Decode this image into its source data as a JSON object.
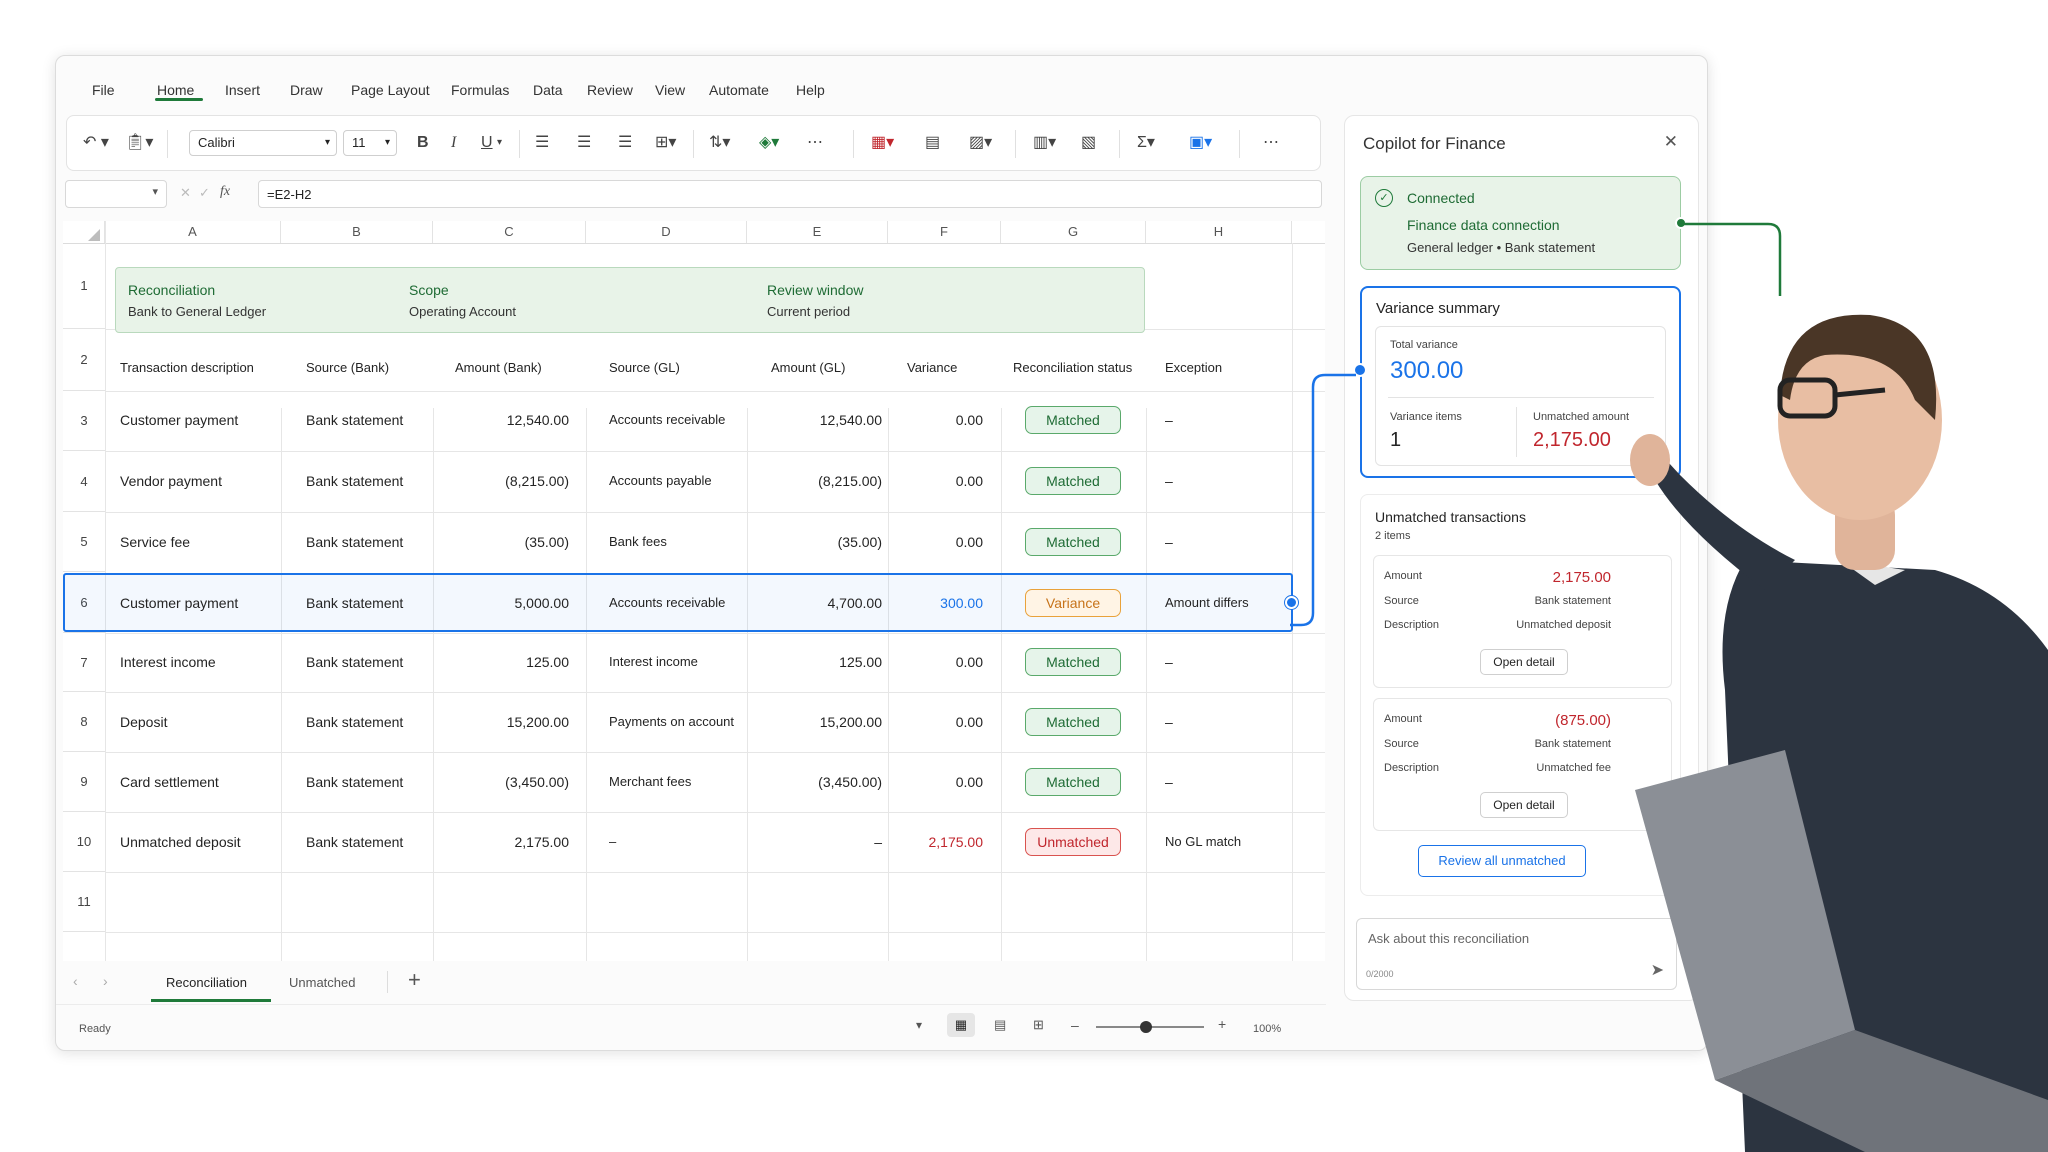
{
  "menu": [
    "File",
    "Home",
    "Insert",
    "Draw",
    "Page Layout",
    "Formulas",
    "Data",
    "Review",
    "View",
    "Automate",
    "Help"
  ],
  "ribbon": {
    "font": "Calibri",
    "size": "11",
    "bold": "B",
    "italic": "I",
    "underline": "U"
  },
  "formula_bar": {
    "fx": "fx",
    "formula": "=E2-H2"
  },
  "columns": [
    "A",
    "B",
    "C",
    "D",
    "E",
    "F",
    "G",
    "H"
  ],
  "banner": {
    "reconciliation_label": "Reconciliation",
    "reconciliation_value": "Bank to General Ledger",
    "scope_label": "Scope",
    "scope_value": "Operating Account",
    "window_label": "Review window",
    "window_value": "Current period"
  },
  "headers": [
    "Transaction description",
    "Source (Bank)",
    "Amount (Bank)",
    "Source (GL)",
    "Amount (GL)",
    "Variance",
    "Reconciliation status",
    "Exception"
  ],
  "row_numbers": [
    "1",
    "2",
    "3",
    "4",
    "5",
    "6",
    "7",
    "8",
    "9",
    "10",
    "11"
  ],
  "rows": [
    {
      "desc": "Customer payment",
      "src_bank": "Bank statement",
      "amt_bank": "12,540.00",
      "src_gl": "Accounts receivable",
      "amt_gl": "12,540.00",
      "variance": "0.00",
      "status": "Matched",
      "exception": "–"
    },
    {
      "desc": "Vendor payment",
      "src_bank": "Bank statement",
      "amt_bank": "(8,215.00)",
      "src_gl": "Accounts payable",
      "amt_gl": "(8,215.00)",
      "variance": "0.00",
      "status": "Matched",
      "exception": "–"
    },
    {
      "desc": "Service fee",
      "src_bank": "Bank statement",
      "amt_bank": "(35.00)",
      "src_gl": "Bank fees",
      "amt_gl": "(35.00)",
      "variance": "0.00",
      "status": "Matched",
      "exception": "–"
    },
    {
      "desc": "Customer payment",
      "src_bank": "Bank statement",
      "amt_bank": "5,000.00",
      "src_gl": "Accounts receivable",
      "amt_gl": "4,700.00",
      "variance": "300.00",
      "status": "Variance",
      "exception": "Amount differs"
    },
    {
      "desc": "Interest income",
      "src_bank": "Bank statement",
      "amt_bank": "125.00",
      "src_gl": "Interest income",
      "amt_gl": "125.00",
      "variance": "0.00",
      "status": "Matched",
      "exception": "–"
    },
    {
      "desc": "Deposit",
      "src_bank": "Bank statement",
      "amt_bank": "15,200.00",
      "src_gl": "Payments on account",
      "amt_gl": "15,200.00",
      "variance": "0.00",
      "status": "Matched",
      "exception": "–"
    },
    {
      "desc": "Card settlement",
      "src_bank": "Bank statement",
      "amt_bank": "(3,450.00)",
      "src_gl": "Merchant fees",
      "amt_gl": "(3,450.00)",
      "variance": "0.00",
      "status": "Matched",
      "exception": "–"
    },
    {
      "desc": "Unmatched deposit",
      "src_bank": "Bank statement",
      "amt_bank": "2,175.00",
      "src_gl": "–",
      "amt_gl": "–",
      "variance": "2,175.00",
      "status": "Unmatched",
      "exception": "No GL match"
    }
  ],
  "sheet_tabs": [
    "Reconciliation",
    "Unmatched"
  ],
  "status_bar": {
    "ready": "Ready",
    "zoom": "100%"
  },
  "copilot": {
    "title": "Copilot for Finance",
    "connected": "Connected",
    "connection_title": "Finance data connection",
    "connection_sub": "General ledger • Bank statement",
    "variance_summary": "Variance summary",
    "total_variance_label": "Total variance",
    "total_variance": "300.00",
    "variance_items_label": "Variance items",
    "variance_items": "1",
    "unmatched_amount_label": "Unmatched amount",
    "unmatched_amount": "2,175.00",
    "unmatched_title": "Unmatched transactions",
    "unmatched_count": "2 items",
    "amount_label": "Amount",
    "source_label": "Source",
    "description_label": "Description",
    "items": [
      {
        "amount": "2,175.00",
        "source": "Bank statement",
        "description": "Unmatched deposit"
      },
      {
        "amount": "(875.00)",
        "source": "Bank statement",
        "description": "Unmatched fee"
      }
    ],
    "open_detail": "Open detail",
    "review_all": "Review all unmatched",
    "ask_placeholder": "Ask about this reconciliation",
    "char_count": "0/2000"
  },
  "colors": {
    "accent_green": "#1f7a3a",
    "blue": "#1a73e8",
    "red": "#c0262d",
    "orange": "#c7731a"
  }
}
